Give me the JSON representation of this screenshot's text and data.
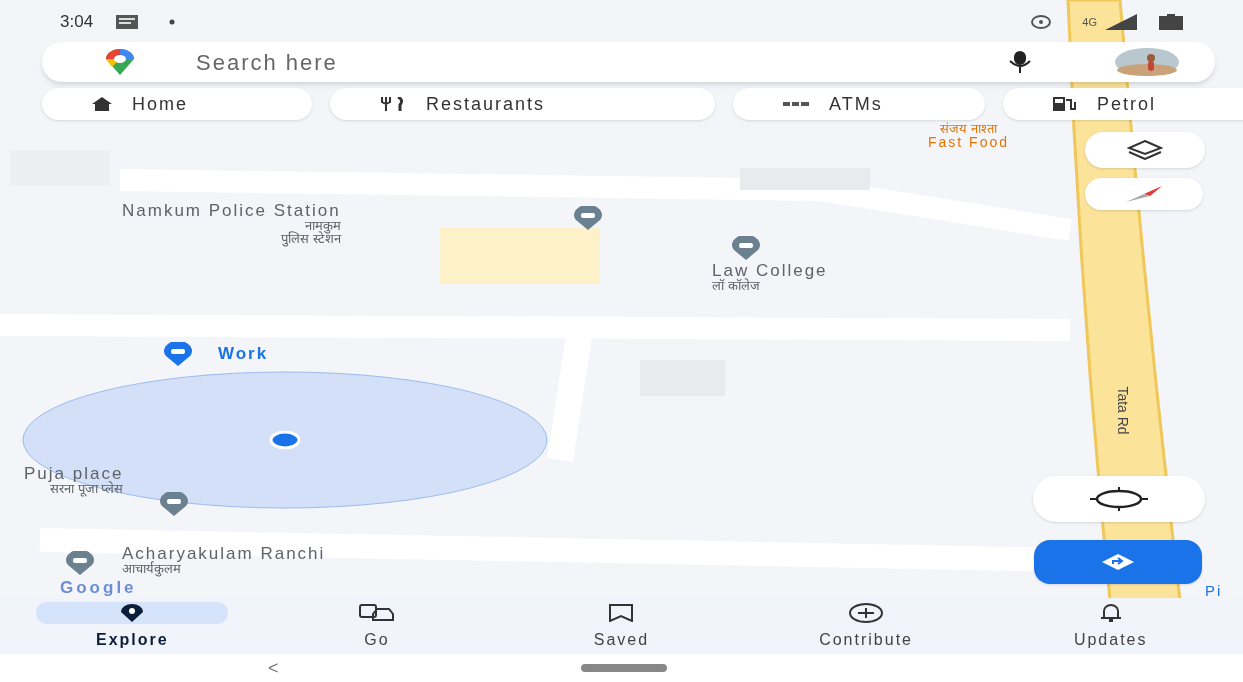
{
  "status_bar": {
    "time": "3:04",
    "network": "4G"
  },
  "map": {
    "places": [
      {
        "kind": "police",
        "name": "Namkum Police Station",
        "local": "नामकुम\nपुलिस स्टेशन"
      },
      {
        "kind": "school",
        "name": "Law College",
        "local": "लॉ कॉलेज"
      },
      {
        "kind": "saved",
        "name": "Work"
      },
      {
        "kind": "worship",
        "name": "Puja place",
        "local": "सरना पूजा प्लेस"
      },
      {
        "kind": "school",
        "name": "Acharyakulam Ranchi",
        "local": "आचार्यकुलम"
      },
      {
        "kind": "food",
        "name": "संजय नाश्ता",
        "local": "Fast Food"
      }
    ],
    "road_label": "Tata Rd",
    "attribution": "Google",
    "edge_label": "Pi"
  },
  "search": {
    "placeholder": "Search here"
  },
  "chips": [
    {
      "label": "Home"
    },
    {
      "label": "Restaurants"
    },
    {
      "label": "ATMs"
    },
    {
      "label": "Petrol"
    }
  ],
  "nav": [
    {
      "label": "Explore",
      "selected": true
    },
    {
      "label": "Go",
      "selected": false
    },
    {
      "label": "Saved",
      "selected": false
    },
    {
      "label": "Contribute",
      "selected": false
    },
    {
      "label": "Updates",
      "selected": false
    }
  ],
  "system_nav": {
    "back": "<"
  }
}
